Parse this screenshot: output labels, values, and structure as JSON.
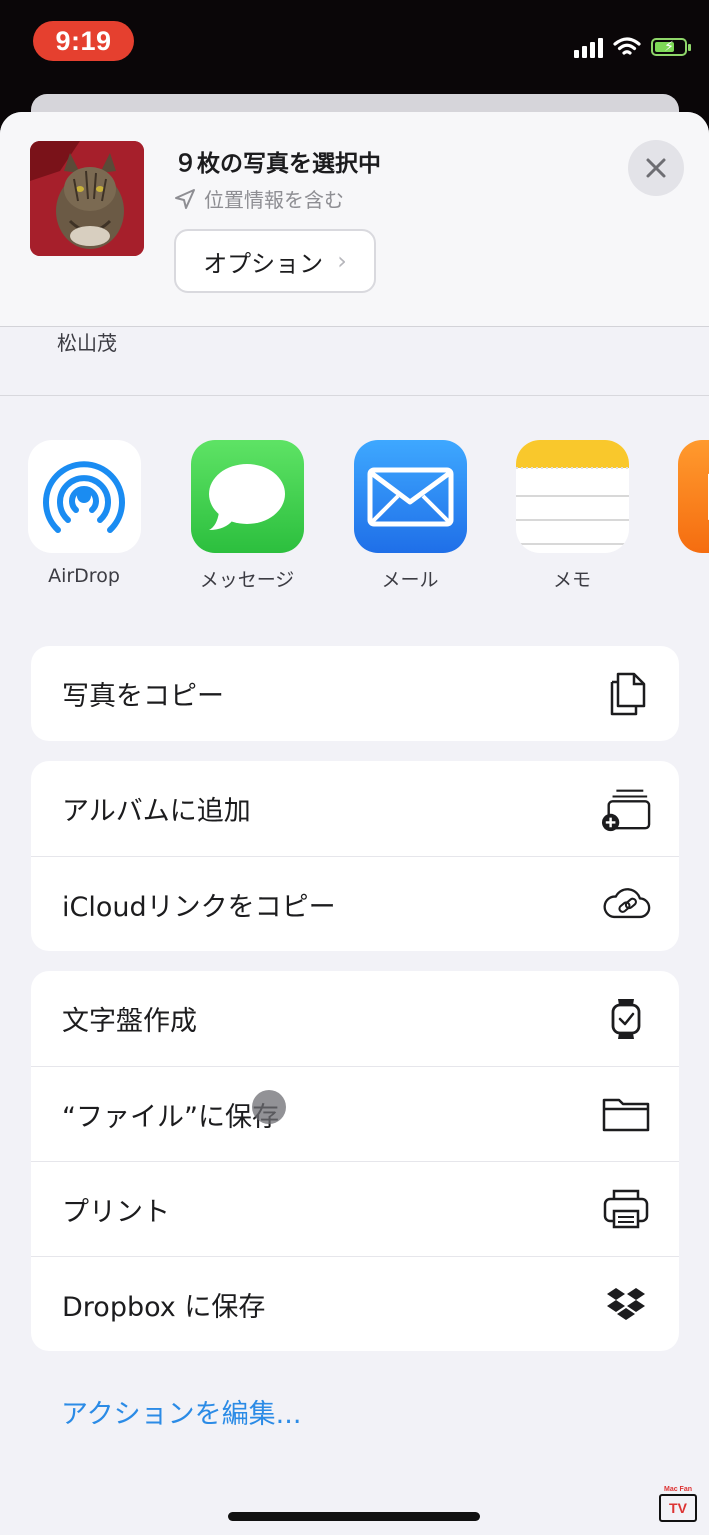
{
  "status_bar": {
    "time": "9:19"
  },
  "header": {
    "title": "９枚の写真を選択中",
    "location": "位置情報を含む",
    "options_label": "オプション"
  },
  "people": {
    "visible_name": "松山茂"
  },
  "apps": [
    {
      "label": "AirDrop",
      "icon": "airdrop-icon"
    },
    {
      "label": "メッセージ",
      "icon": "messages-icon"
    },
    {
      "label": "メール",
      "icon": "mail-icon"
    },
    {
      "label": "メモ",
      "icon": "notes-icon"
    },
    {
      "label": "",
      "icon": "books-icon"
    }
  ],
  "actions": {
    "group1": [
      {
        "label": "写真をコピー",
        "icon": "copy-icon"
      }
    ],
    "group2": [
      {
        "label": "アルバムに追加",
        "icon": "add-to-album-icon"
      },
      {
        "label": "iCloudリンクをコピー",
        "icon": "icloud-link-icon"
      }
    ],
    "group3": [
      {
        "label": "文字盤作成",
        "icon": "watch-icon"
      },
      {
        "label": "“ファイル”に保存",
        "icon": "folder-icon"
      },
      {
        "label": "プリント",
        "icon": "printer-icon"
      },
      {
        "label": "Dropbox に保存",
        "icon": "dropbox-icon"
      }
    ]
  },
  "edit_actions_label": "アクションを編集...",
  "watermark": {
    "top": "Mac Fan",
    "box": "TV"
  },
  "colors": {
    "accent": "#2b8be6",
    "status_pill": "#e5402f"
  }
}
